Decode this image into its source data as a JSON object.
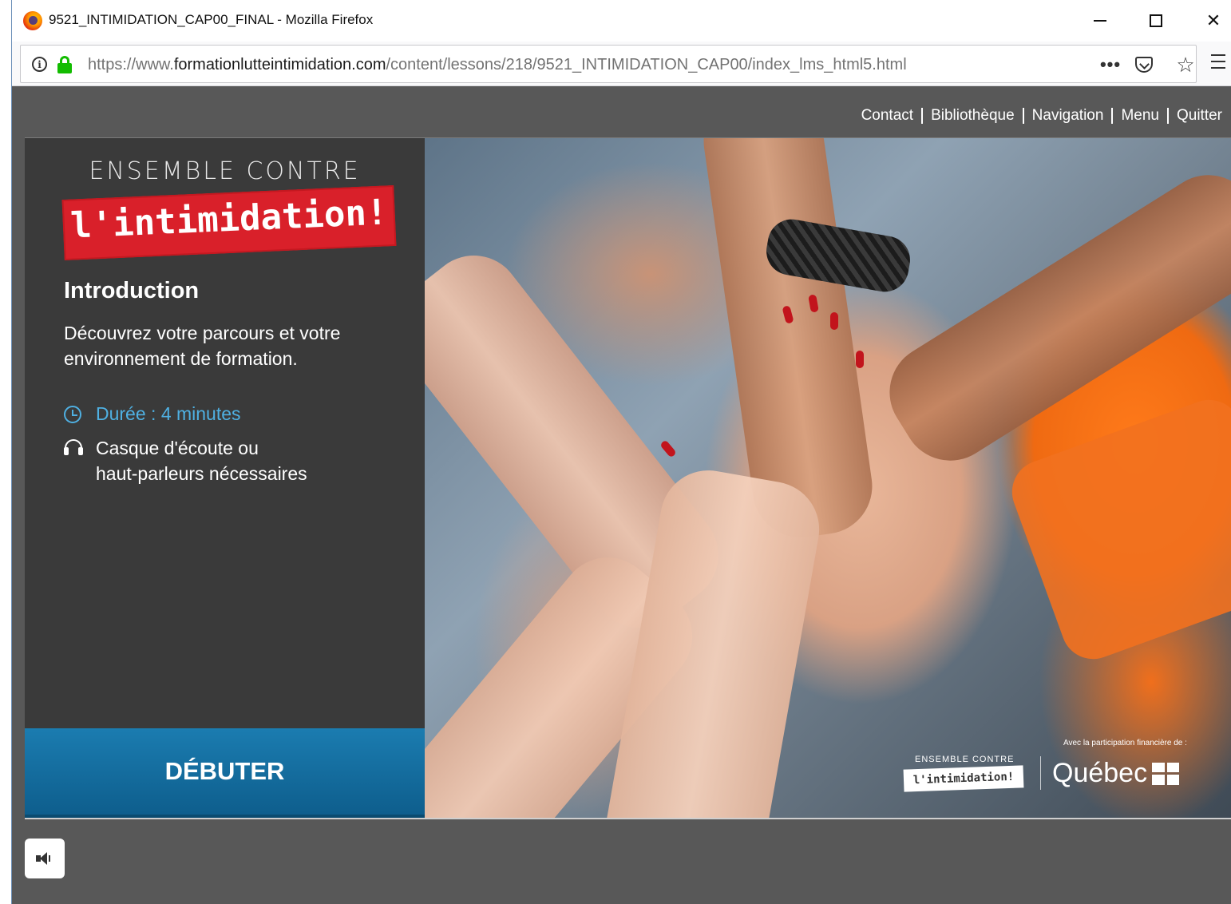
{
  "window": {
    "title": "9521_INTIMIDATION_CAP00_FINAL - Mozilla Firefox",
    "min_icon": "minimize-icon",
    "max_icon": "maximize-icon",
    "close_glyph": "✕"
  },
  "browser": {
    "url_prefix": "https://www.",
    "url_domain": "formationlutteintimidation.com",
    "url_path": "/content/lessons/218/9521_INTIMIDATION_CAP00/index_lms_html5.html",
    "more_glyph": "•••",
    "star_glyph": "☆"
  },
  "topnav": {
    "items": [
      {
        "label": "Contact"
      },
      {
        "label": "Bibliothèque"
      },
      {
        "label": "Navigation"
      },
      {
        "label": "Menu"
      },
      {
        "label": "Quitter"
      }
    ]
  },
  "brand": {
    "top": "ENSEMBLE CONTRE",
    "stamp": "l'intimidation!"
  },
  "lesson": {
    "title": "Introduction",
    "description": "Découvrez votre parcours et votre environnement de formation.",
    "duration": "Durée : 4 minutes",
    "requirement_line1": "Casque d'écoute ou",
    "requirement_line2": "haut-parleurs nécessaires",
    "start_label": "DÉBUTER"
  },
  "photo": {
    "credit": "Avec la participation financière de :",
    "logo_top": "ENSEMBLE CONTRE",
    "logo_stamp": "l'intimidation!",
    "quebec": "Québec"
  },
  "colors": {
    "accent_blue": "#4fb0e2",
    "button_blue": "#1b7cb0",
    "brand_red": "#d9202a",
    "panel": "#3a3a3a",
    "chrome": "#585858"
  }
}
